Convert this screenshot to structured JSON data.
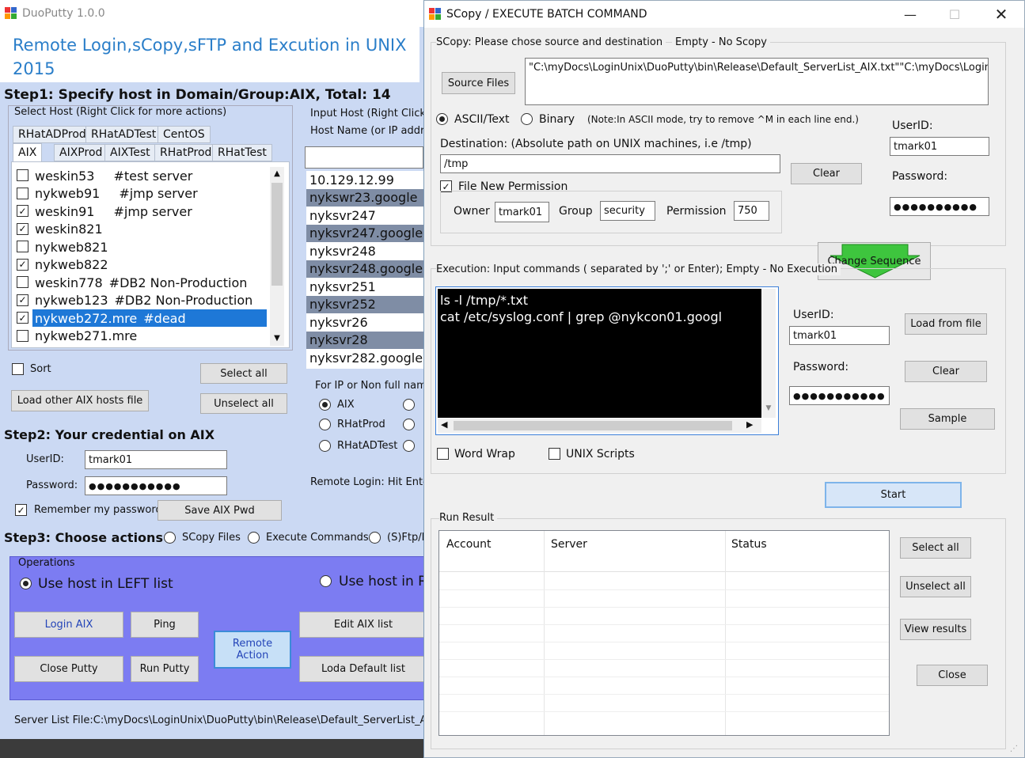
{
  "left": {
    "title": "DuoPutty 1.0.0",
    "heading": "Remote Login,sCopy,sFTP and Excution in UNIX",
    "year": "2015",
    "step1": "Step1: Specify host in Domain/Group:AIX, Total: 14",
    "select_host_label": "Select Host (Right Click for more actions)",
    "tabs_row1": [
      "RHatADProd",
      "RHatADTest",
      "CentOS"
    ],
    "tabs_row2": [
      "AIX",
      "AIXProd",
      "AIXTest",
      "RHatProd",
      "RHatTest"
    ],
    "hosts": [
      {
        "name": "weskin53",
        "note": "#test server",
        "checked": false
      },
      {
        "name": "nykweb91",
        "note": "#jmp server",
        "checked": false
      },
      {
        "name": "weskin91",
        "note": "#jmp server",
        "checked": true
      },
      {
        "name": "weskin821",
        "note": "",
        "checked": true
      },
      {
        "name": "nykweb821",
        "note": "",
        "checked": false
      },
      {
        "name": "nykweb822",
        "note": "",
        "checked": true
      },
      {
        "name": "weskin778",
        "note": "#DB2 Non-Production",
        "checked": false
      },
      {
        "name": "nykweb123",
        "note": "#DB2 Non-Production",
        "checked": true
      },
      {
        "name": "nykweb272.mre",
        "note": "#dead",
        "checked": true,
        "selected": true
      },
      {
        "name": "nykweb271.mre",
        "note": "",
        "checked": false
      }
    ],
    "sort_label": "Sort",
    "select_all": "Select all",
    "unselect_all": "Unselect all",
    "load_other": "Load other AIX hosts file",
    "input_host_label": "Input Host (Right Click f",
    "host_name_label": "Host Name (or IP addre",
    "input_hosts": [
      "10.129.12.99",
      "nykswr23.google",
      "nyksvr247",
      "nyksvr247.google",
      "nyksvr248",
      "nyksvr248.google",
      "nyksvr251",
      "nyksvr252",
      "nyksvr26",
      "nyksvr28",
      "nyksvr282.google"
    ],
    "for_ip_label": "For IP or Non full name",
    "radio_groups": [
      "AIX",
      "RHatProd",
      "RHatADTest"
    ],
    "remote_login_hint": "Remote Login: Hit Enter",
    "step2": "Step2: Your credential on AIX",
    "userid_label": "UserID:",
    "userid": "tmark01",
    "password_label": "Password:",
    "password": "●●●●●●●●●●●",
    "remember": "Remember my password",
    "save_pwd": "Save AIX Pwd",
    "step3": "Step3: Choose actions",
    "actions": [
      "SCopy Files",
      "Execute Commands",
      "(S)Ftp/E"
    ],
    "operations": "Operations",
    "use_left": "Use host in LEFT list",
    "use_right": "Use host in R",
    "buttons": {
      "login": "Login AIX",
      "ping": "Ping",
      "remote": "Remote Action",
      "edit": "Edit AIX list",
      "close_putty": "Close Putty",
      "run_putty": "Run Putty",
      "loda": "Loda Default list"
    },
    "server_list": "Server List File:C:\\myDocs\\LoginUnix\\DuoPutty\\bin\\Release\\Default_ServerList_AIX.tx"
  },
  "right": {
    "title": "SCopy / EXECUTE BATCH COMMAND",
    "scopy_label": "SCopy:  Please chose source and destination",
    "empty_scopy": "Empty - No Scopy",
    "source_files": "Source Files",
    "source_path": "\"C:\\myDocs\\LoginUnix\\DuoPutty\\bin\\Release\\Default_ServerList_AIX.txt\"\"C:\\myDocs\\LoginUni",
    "ascii": "ASCII/Text",
    "binary": "Binary",
    "note": "(Note:In ASCII mode, try to remove ^M in each line end.)",
    "destination_label": "Destination:   (Absolute path on UNIX machines, i.e /tmp)",
    "destination": "/tmp",
    "clear": "Clear",
    "file_perm": "File New Permission",
    "owner_label": "Owner",
    "owner": "tmark01",
    "group_label": "Group",
    "group": "security",
    "perm_label": "Permission",
    "perm": "750",
    "userid_label": "UserID:",
    "userid": "tmark01",
    "password_label": "Password:",
    "password": "●●●●●●●●●●",
    "change_sequence": "Change Sequence",
    "exec_label": "Execution: Input commands ( separated  by ';' or Enter);  Empty - No Execution",
    "cmd1": "ls -l /tmp/*.txt",
    "cmd2": "cat /etc/syslog.conf | grep @nykcon01.googl",
    "exec_userid_label": "UserID:",
    "exec_userid": "tmark01",
    "exec_password_label": "Password:",
    "exec_password": "●●●●●●●●●●●",
    "load_from_file": "Load from file",
    "clear2": "Clear",
    "sample": "Sample",
    "word_wrap": "Word Wrap",
    "unix_scripts": "UNIX Scripts",
    "start": "Start",
    "run_result": "Run Result",
    "columns": [
      "Account",
      "Server",
      "Status"
    ],
    "select_all": "Select all",
    "unselect_all": "Unselect all",
    "view_results": "View results",
    "close": "Close"
  }
}
